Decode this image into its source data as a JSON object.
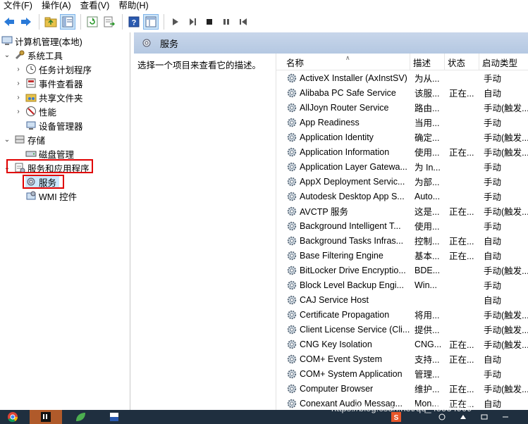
{
  "menu": [
    {
      "label": "文件(F)"
    },
    {
      "label": "操作(A)"
    },
    {
      "label": "查看(V)"
    },
    {
      "label": "帮助(H)"
    }
  ],
  "toolbar_icons": [
    "back-arrow-icon",
    "forward-arrow-icon",
    "folder-up-icon",
    "show-hide-tree-icon",
    "refresh-icon",
    "export-list-icon",
    "help-icon",
    "console-view-icon",
    "play-icon",
    "play-step-icon",
    "stop-icon",
    "pause-icon",
    "restart-icon"
  ],
  "tree": {
    "root": "计算机管理(本地)",
    "system_tools": "系统工具",
    "task_scheduler": "任务计划程序",
    "event_viewer": "事件查看器",
    "shared_folders": "共享文件夹",
    "performance": "性能",
    "device_manager": "设备管理器",
    "storage": "存储",
    "disk_management": "磁盘管理",
    "services_apps": "服务和应用程序",
    "services": "服务",
    "wmi": "WMI 控件"
  },
  "panel": {
    "title": "服务",
    "description_hint": "选择一个项目来查看它的描述。"
  },
  "columns": {
    "name": "名称",
    "desc": "描述",
    "status": "状态",
    "startup": "启动类型"
  },
  "services": [
    {
      "name": "ActiveX Installer (AxInstSV)",
      "desc": "为从...",
      "status": "",
      "startup": "手动"
    },
    {
      "name": "Alibaba PC Safe Service",
      "desc": "该服...",
      "status": "正在...",
      "startup": "自动"
    },
    {
      "name": "AllJoyn Router Service",
      "desc": "路由...",
      "status": "",
      "startup": "手动(触发..."
    },
    {
      "name": "App Readiness",
      "desc": "当用...",
      "status": "",
      "startup": "手动"
    },
    {
      "name": "Application Identity",
      "desc": "确定...",
      "status": "",
      "startup": "手动(触发..."
    },
    {
      "name": "Application Information",
      "desc": "使用...",
      "status": "正在...",
      "startup": "手动(触发..."
    },
    {
      "name": "Application Layer Gatewa...",
      "desc": "为 In...",
      "status": "",
      "startup": "手动"
    },
    {
      "name": "AppX Deployment Servic...",
      "desc": "为部...",
      "status": "",
      "startup": "手动"
    },
    {
      "name": "Autodesk Desktop App S...",
      "desc": "Auto...",
      "status": "",
      "startup": "手动"
    },
    {
      "name": "AVCTP 服务",
      "desc": "这是...",
      "status": "正在...",
      "startup": "手动(触发..."
    },
    {
      "name": "Background Intelligent T...",
      "desc": "使用...",
      "status": "",
      "startup": "手动"
    },
    {
      "name": "Background Tasks Infras...",
      "desc": "控制...",
      "status": "正在...",
      "startup": "自动"
    },
    {
      "name": "Base Filtering Engine",
      "desc": "基本...",
      "status": "正在...",
      "startup": "自动"
    },
    {
      "name": "BitLocker Drive Encryptio...",
      "desc": "BDE...",
      "status": "",
      "startup": "手动(触发..."
    },
    {
      "name": "Block Level Backup Engi...",
      "desc": "Win...",
      "status": "",
      "startup": "手动"
    },
    {
      "name": "CAJ Service Host",
      "desc": "",
      "status": "",
      "startup": "自动"
    },
    {
      "name": "Certificate Propagation",
      "desc": "将用...",
      "status": "",
      "startup": "手动(触发..."
    },
    {
      "name": "Client License Service (Cli...",
      "desc": "提供...",
      "status": "",
      "startup": "手动(触发..."
    },
    {
      "name": "CNG Key Isolation",
      "desc": "CNG...",
      "status": "正在...",
      "startup": "手动(触发..."
    },
    {
      "name": "COM+ Event System",
      "desc": "支持...",
      "status": "正在...",
      "startup": "自动"
    },
    {
      "name": "COM+ System Application",
      "desc": "管理...",
      "status": "",
      "startup": "手动"
    },
    {
      "name": "Computer Browser",
      "desc": "维护...",
      "status": "正在...",
      "startup": "手动(触发..."
    },
    {
      "name": "Conexant Audio Messag...",
      "desc": "Mon...",
      "status": "正在...",
      "startup": "自动"
    }
  ],
  "watermark": "https://blog.csdn.net/qq_45534909",
  "taskbar_icons": [
    "chrome-icon",
    "intellij-icon",
    "leaf-app-icon",
    "app-icon",
    "sogou-ime-icon",
    "system-tray-icons"
  ]
}
